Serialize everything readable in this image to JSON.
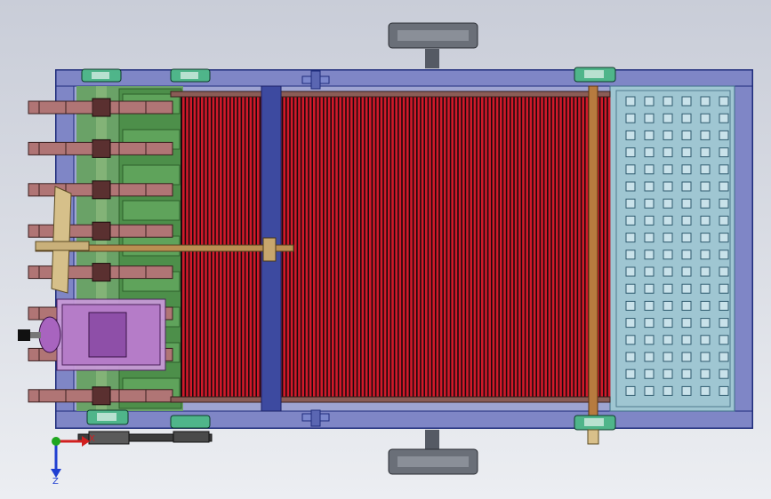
{
  "view": {
    "name": "CAD top view",
    "background": "#d5d8e0"
  },
  "triad": {
    "x_label": "X",
    "z_label": "Z",
    "colors": {
      "x": "#d11f1f",
      "y": "#1fa61f",
      "z": "#1f3fd1"
    }
  },
  "model": {
    "frame_color": "#3f4fa8",
    "frame_fill": "#7f86c6",
    "red_rollers": "#d0192a",
    "green_plate": "#4d8f4a",
    "perforated_plate": "#9fc6d2",
    "bearing_color": "#2f8f6a",
    "motor_color": "#9c52b0",
    "drive_chain_color": "#b07575",
    "feed_fingers_count": 8,
    "perforation_columns": 6,
    "perforation_rows": 18,
    "icon_names": [
      "coordinate-triad-icon",
      "wheel-icon",
      "bearing-icon",
      "motor-icon"
    ]
  }
}
